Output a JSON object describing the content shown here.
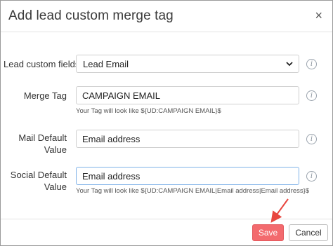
{
  "dialog": {
    "title": "Add lead custom merge tag",
    "close_glyph": "×"
  },
  "fields": {
    "lead_custom_fields": {
      "label": "Lead custom fields",
      "value": "Lead Email"
    },
    "merge_tag": {
      "label": "Merge Tag",
      "value": "CAMPAIGN EMAIL",
      "hint": "Your Tag will look like   ${UD:CAMPAIGN EMAIL}$"
    },
    "mail_default": {
      "label_line1": "Mail Default",
      "label_line2": "Value",
      "value": "Email address"
    },
    "social_default": {
      "label_line1": "Social Default",
      "label_line2": "Value",
      "value": "Email address",
      "hint": "Your Tag will look like   ${UD:CAMPAIGN EMAIL|Email address|Email address}$"
    }
  },
  "footer": {
    "save_label": "Save",
    "cancel_label": "Cancel"
  },
  "icons": {
    "info": "i",
    "chevron": "chevron-down-icon",
    "annotation_arrow_color": "#e8463f"
  },
  "colors": {
    "save_bg": "#f36a6e",
    "focus_border": "#7fb2e8"
  }
}
